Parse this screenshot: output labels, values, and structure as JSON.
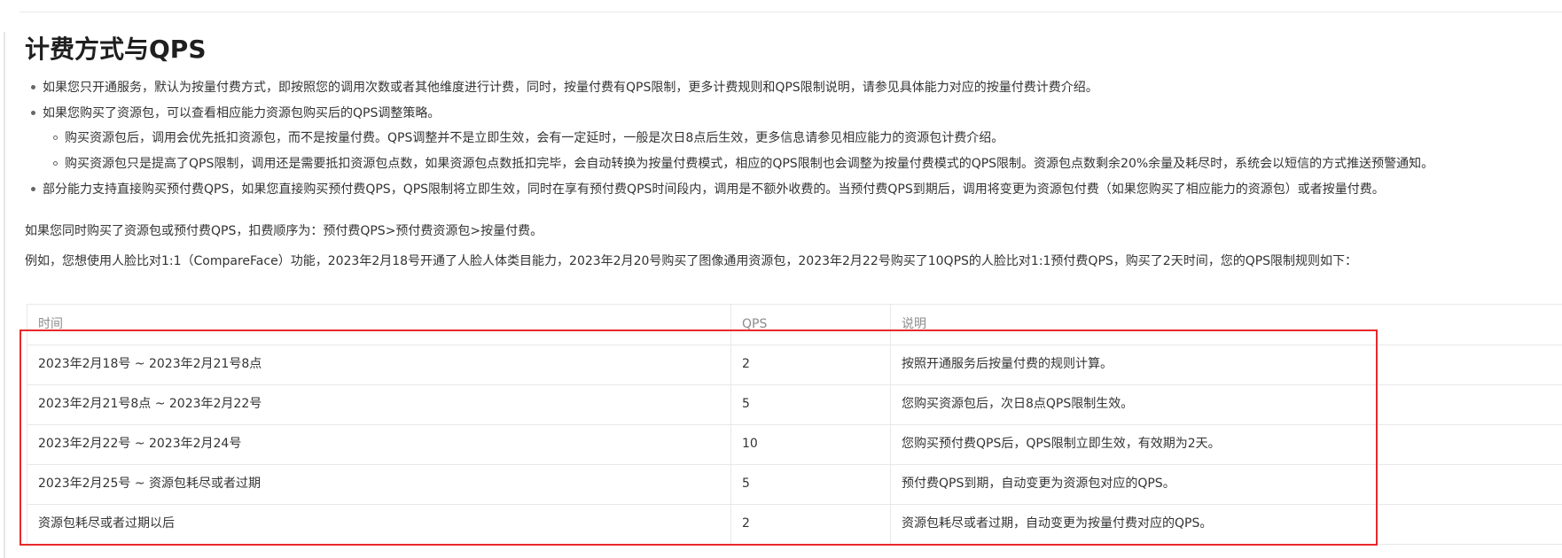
{
  "title": "计费方式与QPS",
  "bullets": [
    "如果您只开通服务，默认为按量付费方式，即按照您的调用次数或者其他维度进行计费，同时，按量付费有QPS限制，更多计费规则和QPS限制说明，请参见具体能力对应的按量付费计费介绍。",
    "如果您购买了资源包，可以查看相应能力资源包购买后的QPS调整策略。",
    "部分能力支持直接购买预付费QPS，如果您直接购买预付费QPS，QPS限制将立即生效，同时在享有预付费QPS时间段内，调用是不额外收费的。当预付费QPS到期后，调用将变更为资源包付费（如果您购买了相应能力的资源包）或者按量付费。"
  ],
  "sub_bullets": [
    "购买资源包后，调用会优先抵扣资源包，而不是按量付费。QPS调整并不是立即生效，会有一定延时，一般是次日8点后生效，更多信息请参见相应能力的资源包计费介绍。",
    "购买资源包只是提高了QPS限制，调用还是需要抵扣资源包点数，如果资源包点数抵扣完毕，会自动转换为按量付费模式，相应的QPS限制也会调整为按量付费模式的QPS限制。资源包点数剩余20%余量及耗尽时，系统会以短信的方式推送预警通知。"
  ],
  "paragraphs": {
    "deduction_order": "如果您同时购买了资源包或预付费QPS，扣费顺序为：预付费QPS>预付费资源包>按量付费。",
    "example": "例如，您想使用人脸比对1:1（CompareFace）功能，2023年2月18号开通了人脸人体类目能力，2023年2月20号购买了图像通用资源包，2023年2月22号购买了10QPS的人脸比对1:1预付费QPS，购买了2天时间，您的QPS限制规则如下："
  },
  "table": {
    "headers": [
      "时间",
      "QPS",
      "说明"
    ],
    "rows": [
      [
        "2023年2月18号 ~ 2023年2月21号8点",
        "2",
        "按照开通服务后按量付费的规则计算。"
      ],
      [
        "2023年2月21号8点 ~ 2023年2月22号",
        "5",
        "您购买资源包后，次日8点QPS限制生效。"
      ],
      [
        "2023年2月22号 ~ 2023年2月24号",
        "10",
        "您购买预付费QPS后，QPS限制立即生效，有效期为2天。"
      ],
      [
        "2023年2月25号 ~ 资源包耗尽或者过期",
        "5",
        "预付费QPS到期，自动变更为资源包对应的QPS。"
      ],
      [
        "资源包耗尽或者过期以后",
        "2",
        "资源包耗尽或者过期，自动变更为按量付费对应的QPS。"
      ]
    ]
  },
  "colors": {
    "highlight_border": "#e8282b",
    "text": "#333333",
    "header_text": "#8c8c8c"
  }
}
